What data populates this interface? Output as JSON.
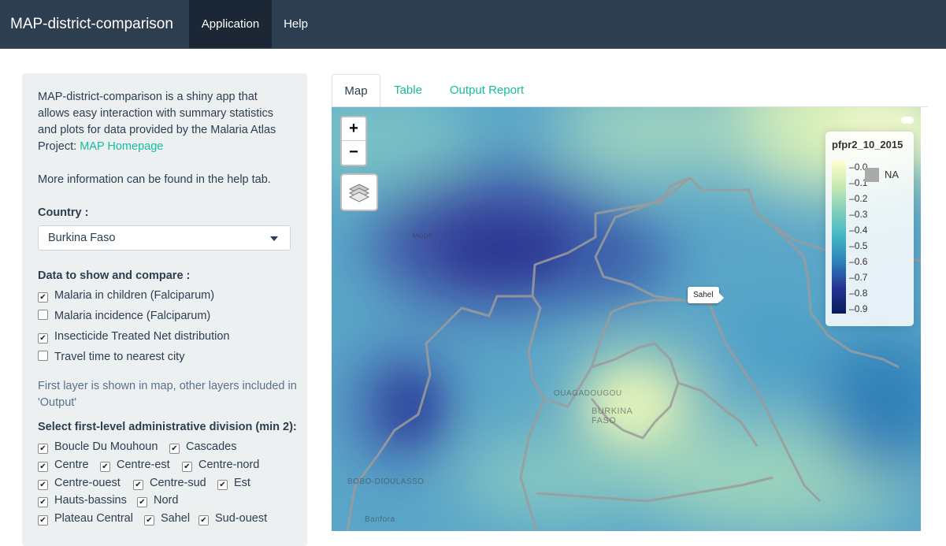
{
  "navbar": {
    "brand": "MAP-district-comparison",
    "items": [
      {
        "label": "Application",
        "active": true
      },
      {
        "label": "Help",
        "active": false
      }
    ]
  },
  "sidebar": {
    "intro_text": "MAP-district-comparison is a shiny app that allows easy interaction with summary statistics and plots for data provided by the Malaria Atlas Project:",
    "intro_link": "MAP Homepage",
    "more_info": "More information can be found in the help tab.",
    "country_label": "Country :",
    "country_value": "Burkina Faso",
    "data_label": "Data to show and compare :",
    "data_options": [
      {
        "label": "Malaria in children (Falciparum)",
        "checked": true
      },
      {
        "label": "Malaria incidence (Falciparum)",
        "checked": false
      },
      {
        "label": "Insecticide Treated Net distribution",
        "checked": true
      },
      {
        "label": "Travel time to nearest city",
        "checked": false
      }
    ],
    "layer_note": "First layer is shown in map, other layers included in 'Output'",
    "admin_label": "Select first-level administrative division (min 2):",
    "admin_options": [
      {
        "label": "Boucle Du Mouhoun",
        "checked": true
      },
      {
        "label": "Cascades",
        "checked": true
      },
      {
        "label": "Centre",
        "checked": true
      },
      {
        "label": "Centre-est",
        "checked": true
      },
      {
        "label": "Centre-nord",
        "checked": true
      },
      {
        "label": "Centre-ouest",
        "checked": true
      },
      {
        "label": "Centre-sud",
        "checked": true
      },
      {
        "label": "Est",
        "checked": true
      },
      {
        "label": "Hauts-bassins",
        "checked": true
      },
      {
        "label": "Nord",
        "checked": true
      },
      {
        "label": "Plateau Central",
        "checked": true
      },
      {
        "label": "Sahel",
        "checked": true
      },
      {
        "label": "Sud-ouest",
        "checked": true
      }
    ]
  },
  "tabs": [
    {
      "label": "Map",
      "active": true
    },
    {
      "label": "Table",
      "active": false
    },
    {
      "label": "Output Report",
      "active": false
    }
  ],
  "map": {
    "zoom_in": "+",
    "zoom_out": "−",
    "tooltip": "Sahel",
    "legend": {
      "title": "pfpr2_10_2015",
      "labels": [
        "0.0",
        "0.1",
        "0.2",
        "0.3",
        "0.4",
        "0.5",
        "0.6",
        "0.7",
        "0.8",
        "0.9"
      ],
      "na_label": "NA",
      "color_low": "#ffffcc",
      "color_high": "#081d58"
    },
    "cities": [
      "Mopti",
      "OUAGADOUGOU",
      "BURKINA FASO",
      "BOBO-DIOULASSO",
      "Banfora"
    ]
  },
  "colors": {
    "navbar": "#2d3e50",
    "accent": "#18bc9c",
    "sidebar_bg": "#ecf0f1"
  }
}
